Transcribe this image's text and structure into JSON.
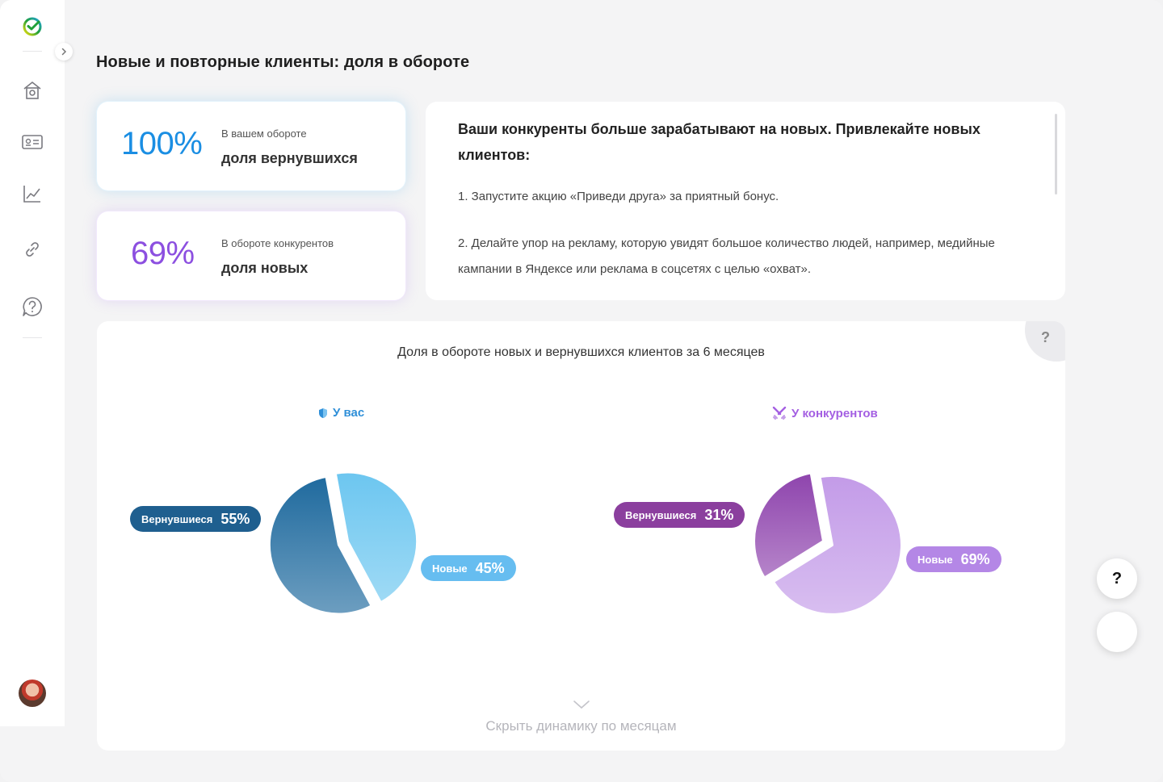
{
  "page": {
    "title": "Новые и повторные клиенты: доля в обороте"
  },
  "stats": [
    {
      "value": "100%",
      "caption": "В вашем обороте",
      "label": "доля вернувшихся",
      "color": "#1a8ee3"
    },
    {
      "value": "69%",
      "caption": "В обороте конкурентов",
      "label": "доля новых",
      "color": "#8c4fe0"
    }
  ],
  "advice": {
    "title": "Ваши конкуренты больше зарабатывают на новых. Привлекайте новых клиентов:",
    "items": [
      "1. Запустите акцию «Приведи друга» за приятный бонус.",
      "2. Делайте упор на рекламу, которую увидят большое количество людей, например, медийные кампании в Яндексе или реклама в соцсетях с целью «охват»."
    ]
  },
  "chart": {
    "title": "Доля в обороте новых и вернувшихся клиентов за 6 месяцев",
    "help_label": "?",
    "collapse_label": "Скрыть динамику по месяцам"
  },
  "chart_data": [
    {
      "type": "pie",
      "title": "У вас",
      "categories": [
        "Вернувшиеся",
        "Новые"
      ],
      "values": [
        55,
        45
      ],
      "value_labels": [
        "55%",
        "45%"
      ],
      "colors": [
        "#1f6a9e",
        "#6cc6f0"
      ]
    },
    {
      "type": "pie",
      "title": "У конкурентов",
      "categories": [
        "Вернувшиеся",
        "Новые"
      ],
      "values": [
        31,
        69
      ],
      "value_labels": [
        "31%",
        "69%"
      ],
      "colors": [
        "#8e44ad",
        "#c39be8"
      ]
    }
  ],
  "fab": {
    "help_label": "?"
  },
  "colors": {
    "brand_green": "#21a038",
    "blue": "#1a8ee3",
    "purple": "#8c4fe0"
  }
}
